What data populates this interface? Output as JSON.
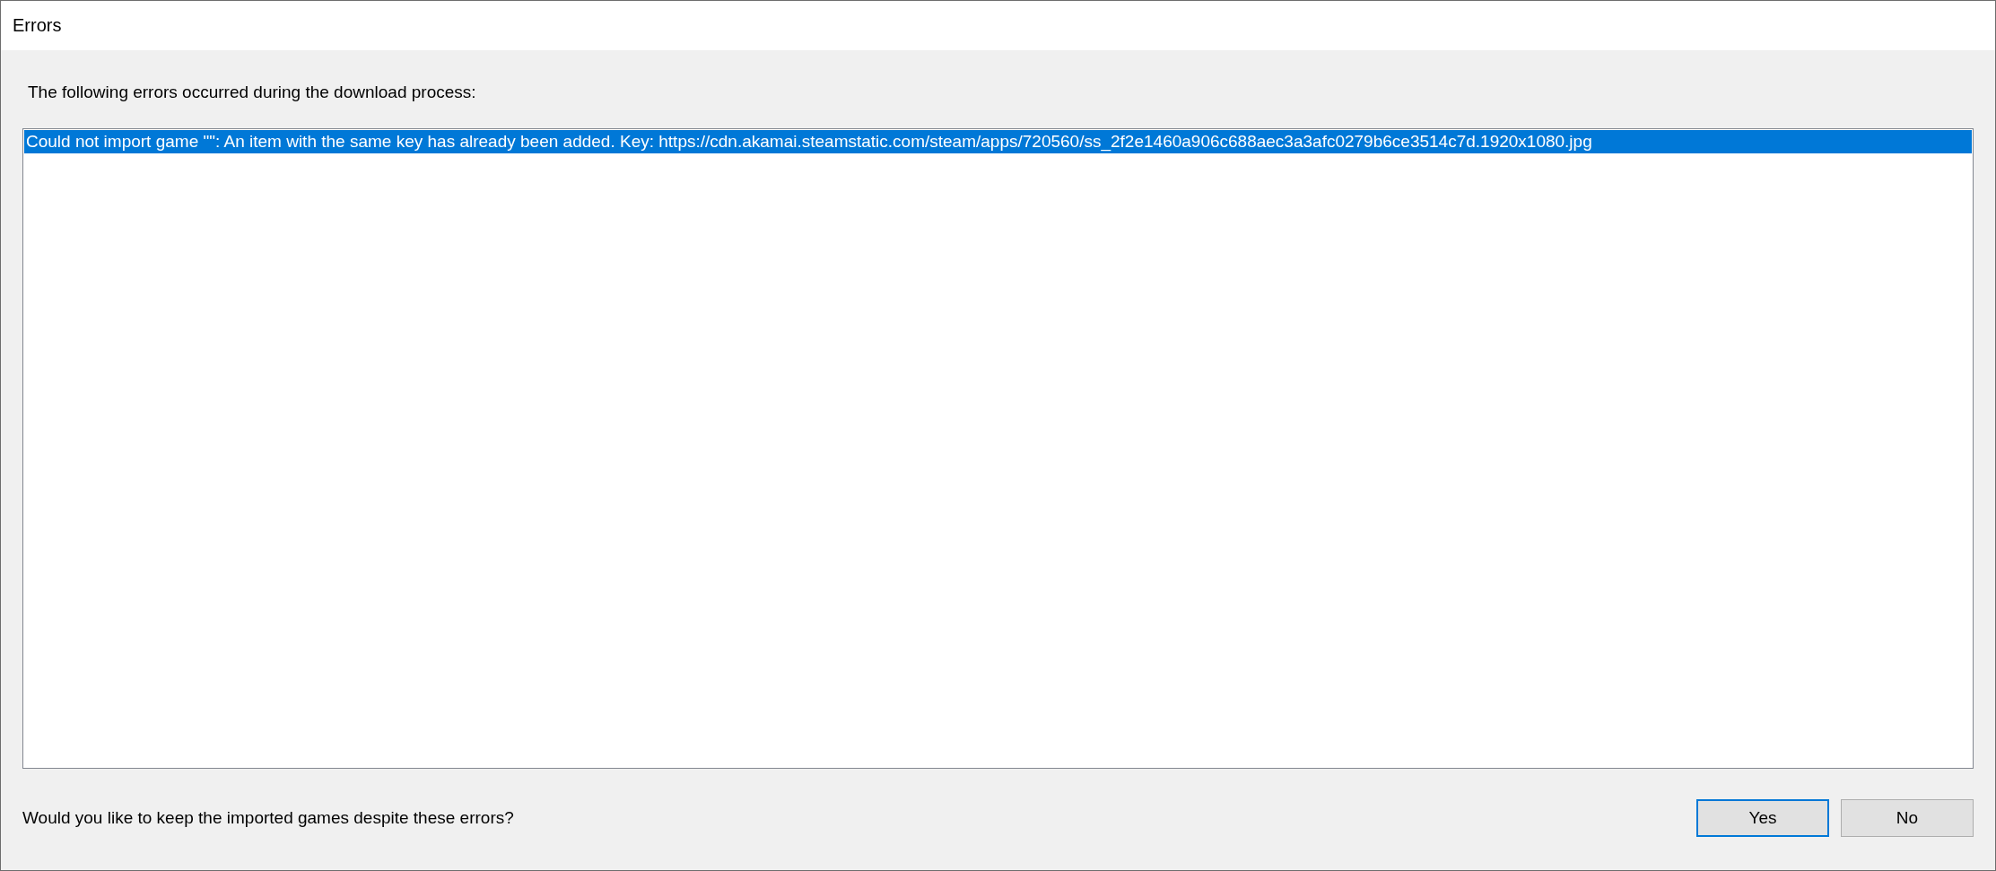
{
  "window": {
    "title": "Errors"
  },
  "message": "The following errors occurred during the download process:",
  "errors": [
    {
      "text": "Could not import game \"\": An item with the same key has already been added. Key: https://cdn.akamai.steamstatic.com/steam/apps/720560/ss_2f2e1460a906c688aec3a3afc0279b6ce3514c7d.1920x1080.jpg",
      "selected": true
    }
  ],
  "question": "Would you like to keep the imported games despite these errors?",
  "buttons": [
    {
      "label": "Yes",
      "default": true
    },
    {
      "label": "No",
      "default": false
    }
  ]
}
